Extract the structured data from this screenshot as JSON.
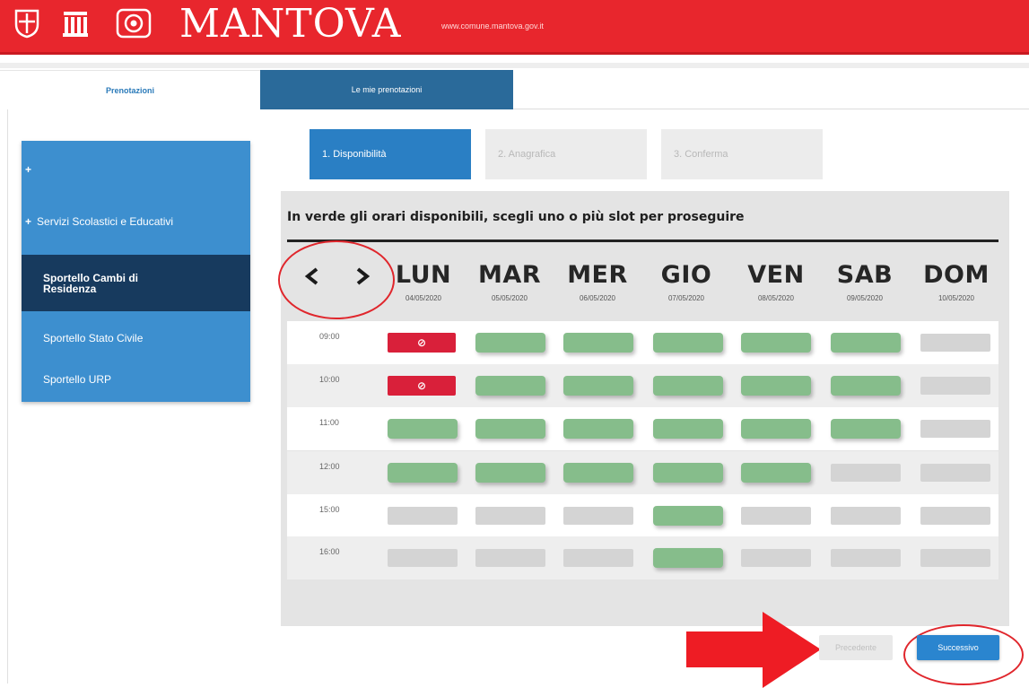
{
  "header": {
    "title": "MANTOVA",
    "url": "www.comune.mantova.gov.it",
    "crests": [
      "crest-icon",
      "tower-icon",
      "seal-icon"
    ],
    "color": "#e8262d"
  },
  "tabs": [
    {
      "label": "Prenotazioni",
      "active": true
    },
    {
      "label": "Le mie prenotazioni",
      "active": false
    }
  ],
  "sidebar": {
    "items": [
      {
        "label": "",
        "prefix": "+"
      },
      {
        "label": "Servizi Scolastici e Educativi",
        "prefix": "+"
      },
      {
        "label": "Sportello Cambi di Residenza",
        "active": true
      },
      {
        "label": "Sportello Stato Civile"
      },
      {
        "label": "Sportello URP"
      }
    ]
  },
  "steps": [
    {
      "label": "1. Disponibilità",
      "active": true
    },
    {
      "label": "2. Anagrafica",
      "active": false
    },
    {
      "label": "3. Conferma",
      "active": false
    }
  ],
  "calendar": {
    "instruction": "In verde gli orari disponibili, scegli uno o più slot per proseguire",
    "prev_icon": "‹",
    "next_icon": "›",
    "days": [
      {
        "name": "LUN",
        "date": "04/05/2020"
      },
      {
        "name": "MAR",
        "date": "05/05/2020"
      },
      {
        "name": "MER",
        "date": "06/05/2020"
      },
      {
        "name": "GIO",
        "date": "07/05/2020"
      },
      {
        "name": "VEN",
        "date": "08/05/2020"
      },
      {
        "name": "SAB",
        "date": "09/05/2020"
      },
      {
        "name": "DOM",
        "date": "10/05/2020"
      }
    ],
    "rows": [
      {
        "time": "09:00",
        "slots": [
          "blocked",
          "available",
          "available",
          "available",
          "available",
          "available",
          "empty"
        ]
      },
      {
        "time": "10:00",
        "slots": [
          "blocked",
          "available",
          "available",
          "available",
          "available",
          "available",
          "empty"
        ]
      },
      {
        "time": "11:00",
        "slots": [
          "available",
          "available",
          "available",
          "available",
          "available",
          "available",
          "empty"
        ]
      },
      {
        "time": "12:00",
        "slots": [
          "available",
          "available",
          "available",
          "available",
          "available",
          "empty",
          "empty"
        ]
      },
      {
        "time": "15:00",
        "slots": [
          "empty",
          "empty",
          "empty",
          "available",
          "empty",
          "empty",
          "empty"
        ]
      },
      {
        "time": "16:00",
        "slots": [
          "empty",
          "empty",
          "empty",
          "available",
          "empty",
          "empty",
          "empty"
        ]
      }
    ],
    "blocked_icon": "⊘",
    "colors": {
      "available": "#86bd8b",
      "blocked": "#d9203a",
      "empty": "#d4d4d4"
    }
  },
  "buttons": {
    "prev_label": "Precedente",
    "next_label": "Successivo"
  },
  "annotation_color": "#e0262c"
}
